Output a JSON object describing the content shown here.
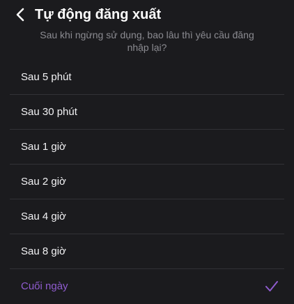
{
  "header": {
    "back_icon": "chevron-left-icon",
    "title": "Tự động đăng xuất",
    "subtitle": "Sau khi ngừng sử dụng, bao lâu thì yêu cầu đăng nhập lại?"
  },
  "options": [
    {
      "label": "Sau 5 phút",
      "selected": false
    },
    {
      "label": "Sau 30 phút",
      "selected": false
    },
    {
      "label": "Sau 1 giờ",
      "selected": false
    },
    {
      "label": "Sau 2 giờ",
      "selected": false
    },
    {
      "label": "Sau 4 giờ",
      "selected": false
    },
    {
      "label": "Sau 8 giờ",
      "selected": false
    },
    {
      "label": "Cuối ngày",
      "selected": true,
      "check_icon": "checkmark-icon"
    }
  ],
  "colors": {
    "background": "#1b1b1e",
    "text": "#f2f2f4",
    "subtitle": "#8b8b91",
    "accent": "#8f5ccf",
    "divider": "#323236"
  }
}
